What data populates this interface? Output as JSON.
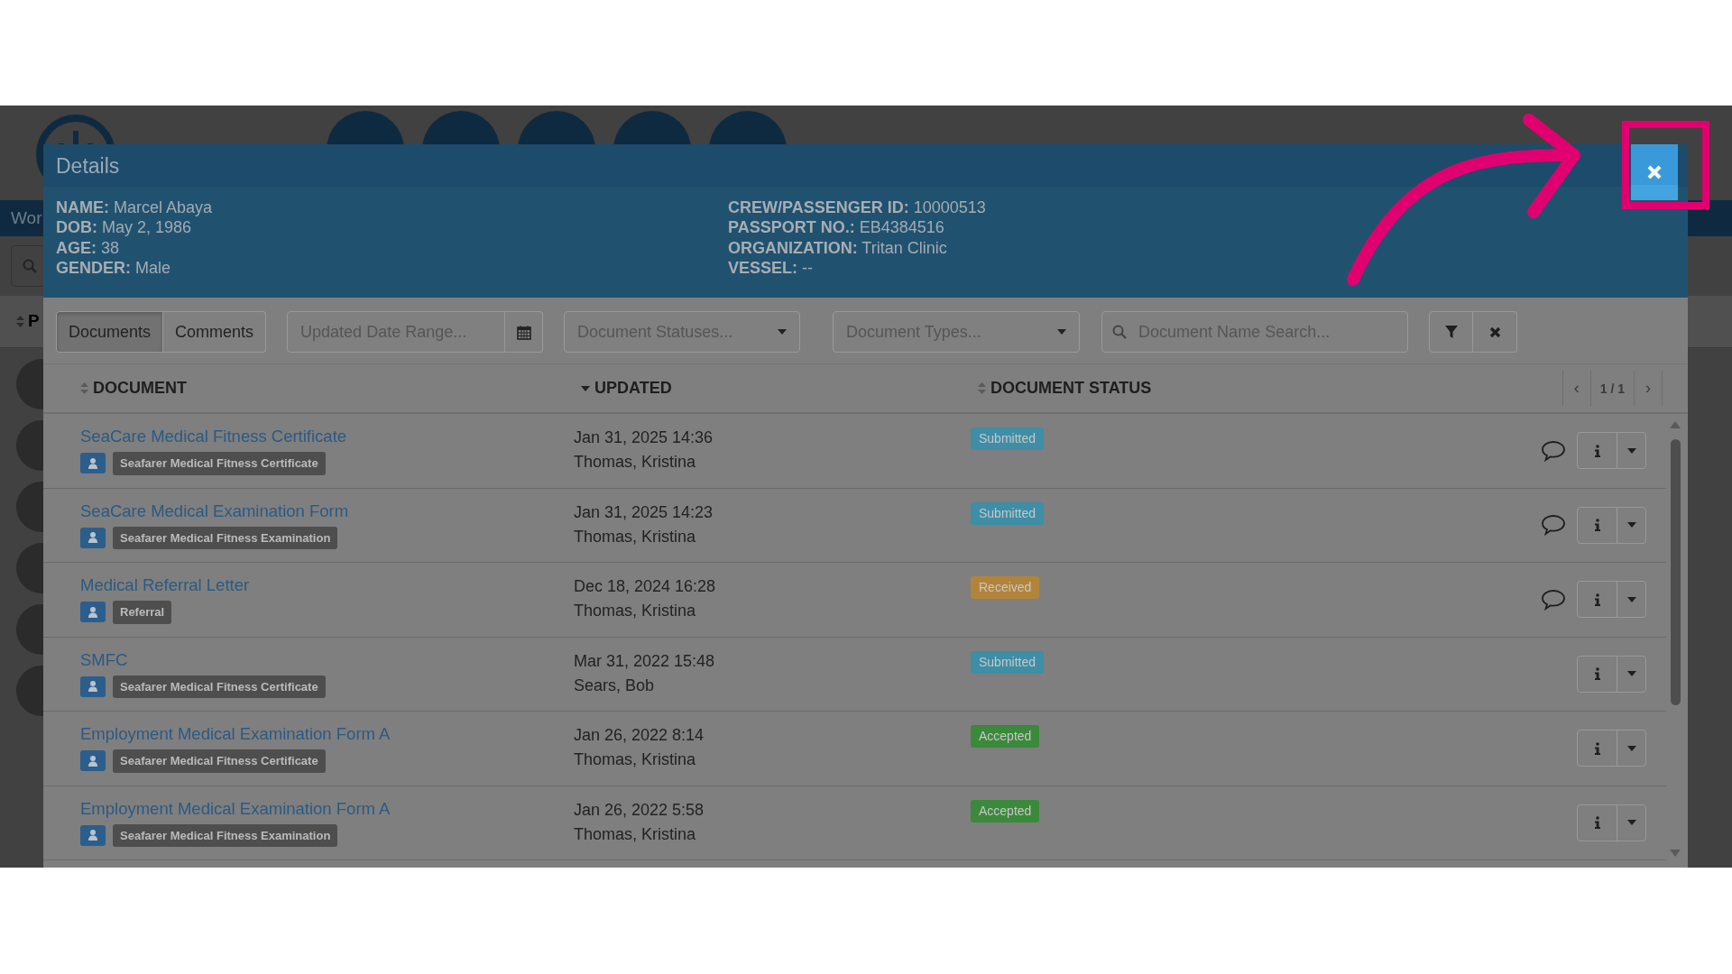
{
  "background": {
    "tab_fragment": "Wor",
    "column_fragment": "P"
  },
  "dialog": {
    "title": "Details",
    "info_left": [
      "**NAME:** Marcel Abaya",
      "**DOB:** May 2, 1986",
      "**AGE:** 38",
      "**GENDER:** Male"
    ],
    "info_right": [
      "**CREW/PASSENGER ID:** 10000513",
      "**PASSPORT NO.:** EB4384516",
      "**ORGANIZATION:** Tritan Clinic",
      "**VESSEL:** --"
    ],
    "tabs": [
      {
        "label": "Documents",
        "selected": true
      },
      {
        "label": "Comments",
        "selected": false
      }
    ],
    "filters": {
      "date_range": {
        "placeholder": "Updated Date Range..."
      },
      "statuses": {
        "placeholder": "Document Statuses..."
      },
      "types": {
        "placeholder": "Document Types..."
      },
      "search": {
        "placeholder": "Document Name Search..."
      }
    },
    "table": {
      "columns": [
        {
          "label": "DOCUMENT",
          "kind": "sortable"
        },
        {
          "label": "UPDATED",
          "kind": "sorted-desc"
        },
        {
          "label": "DOCUMENT STATUS",
          "kind": "sortable"
        }
      ],
      "pager": "1 / 1",
      "pager_prev": "‹",
      "pager_next": "›",
      "rows": [
        {
          "title": "SeaCare Medical Fitness Certificate",
          "tag": "Seafarer Medical Fitness Certificate",
          "date": "Jan 31, 2025 14:36",
          "author": "Thomas, Kristina",
          "status": "Submitted",
          "color": "#3d8ea6",
          "has_comments": true
        },
        {
          "title": "SeaCare Medical Examination Form",
          "tag": "Seafarer Medical Fitness Examination",
          "date": "Jan 31, 2025 14:23",
          "author": "Thomas, Kristina",
          "status": "Submitted",
          "color": "#3d8ea6",
          "has_comments": true
        },
        {
          "title": "Medical Referral Letter",
          "tag": "Referral",
          "date": "Dec 18, 2024 16:28",
          "author": "Thomas, Kristina",
          "status": "Received",
          "color": "#b2843a",
          "has_comments": true
        },
        {
          "title": "SMFC",
          "tag": "Seafarer Medical Fitness Certificate",
          "date": "Mar 31, 2022 15:48",
          "author": "Sears, Bob",
          "status": "Submitted",
          "color": "#3d8ea6",
          "has_comments": false
        },
        {
          "title": "Employment Medical Examination Form A",
          "tag": "Seafarer Medical Fitness Certificate",
          "date": "Jan 26, 2022 8:14",
          "author": "Thomas, Kristina",
          "status": "Accepted",
          "color": "#3b893b",
          "has_comments": false
        },
        {
          "title": "Employment Medical Examination Form A",
          "tag": "Seafarer Medical Fitness Examination",
          "date": "Jan 26, 2022 5:58",
          "author": "Thomas, Kristina",
          "status": "Accepted",
          "color": "#3b893b",
          "has_comments": false
        }
      ]
    }
  }
}
